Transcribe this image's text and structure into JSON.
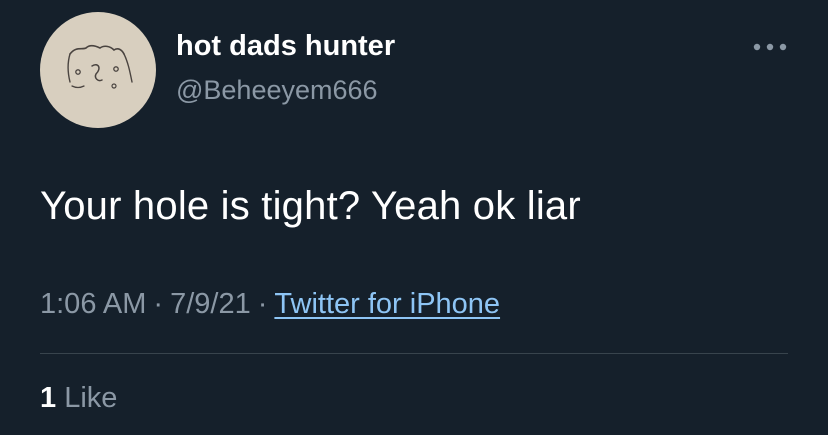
{
  "theme": {
    "background": "#15202b",
    "text_primary": "#ffffff",
    "text_secondary": "#8b98a5",
    "link": "#8ec5f5",
    "divider": "#38444d",
    "avatar_bg": "#d8cfbf"
  },
  "author": {
    "display_name": "hot dads hunter",
    "handle": "@Beheeyem666",
    "avatar_icon": "doodle-face-avatar"
  },
  "more_icon": "more-horizontal-icon",
  "tweet": {
    "text": "Your hole is tight? Yeah ok liar",
    "time": "1:06 AM",
    "date": "7/9/21",
    "separator": "·",
    "source": "Twitter for iPhone"
  },
  "engagement": {
    "like_count": "1",
    "like_label": "Like"
  }
}
